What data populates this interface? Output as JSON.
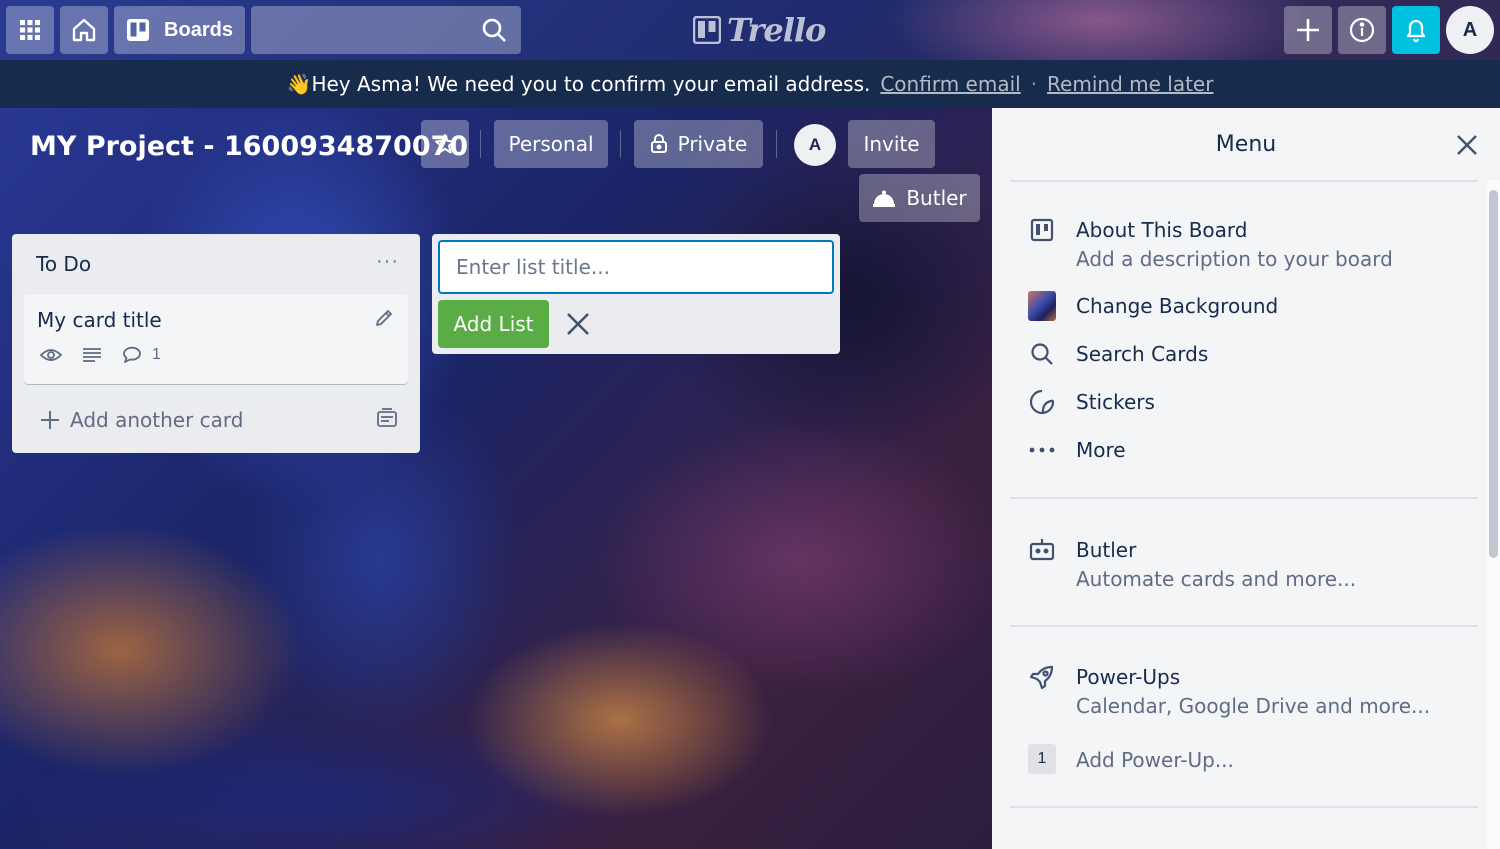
{
  "header": {
    "boards_label": "Boards",
    "search_value": "",
    "logo_text": "Trello",
    "avatar_initial": "A"
  },
  "banner": {
    "emoji": "👋",
    "message": "Hey Asma! We need you to confirm your email address.",
    "confirm_link": "Confirm email",
    "separator": "·",
    "remind_link": "Remind me later"
  },
  "board": {
    "title": "MY Project - 1600934870070",
    "team_label": "Personal",
    "visibility_label": "Private",
    "member_initial": "A",
    "invite_label": "Invite",
    "butler_label": "Butler"
  },
  "lists": [
    {
      "title": "To Do",
      "menu": "···",
      "cards": [
        {
          "title": "My card title",
          "comment_count": "1"
        }
      ],
      "add_card_label": "Add another card"
    }
  ],
  "composer": {
    "placeholder": "Enter list title...",
    "value": "",
    "add_button": "Add List"
  },
  "menu": {
    "title": "Menu",
    "items": [
      {
        "label": "About This Board",
        "sublabel": "Add a description to your board",
        "icon": "board-icon"
      },
      {
        "label": "Change Background",
        "icon": "background-thumbnail"
      },
      {
        "label": "Search Cards",
        "icon": "search-icon"
      },
      {
        "label": "Stickers",
        "icon": "sticker-icon"
      },
      {
        "label": "More",
        "icon": "more-icon"
      }
    ],
    "butler": {
      "label": "Butler",
      "sublabel": "Automate cards and more...",
      "icon": "butler-icon"
    },
    "powerups": {
      "label": "Power-Ups",
      "sublabel": "Calendar, Google Drive and more...",
      "icon": "rocket-icon",
      "count": "1",
      "add_label": "Add Power-Up..."
    }
  },
  "colors": {
    "banner_bg": "#172b4d",
    "add_list_green": "#5aac44",
    "input_border_blue": "#0079bf",
    "notification_cyan": "#00c2e0",
    "list_bg": "#ebecf0",
    "menu_bg": "#f4f5f7"
  }
}
